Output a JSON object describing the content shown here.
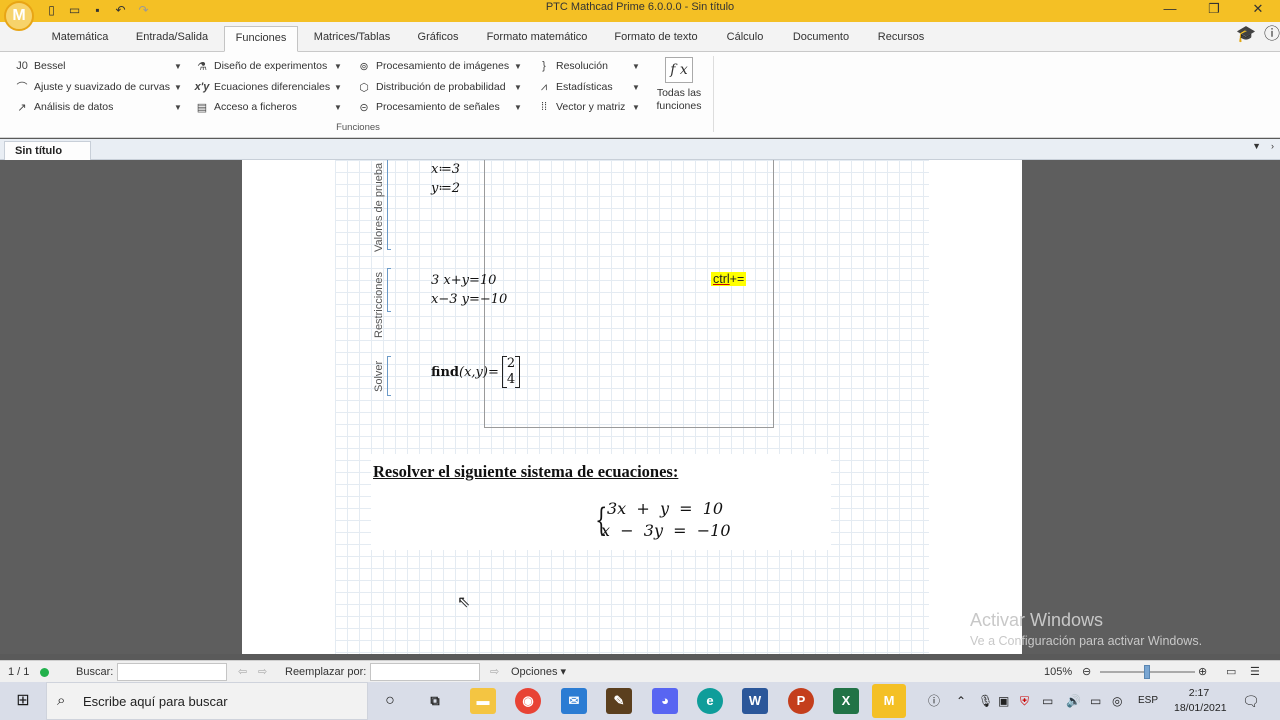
{
  "window": {
    "title": "PTC Mathcad Prime 6.0.0.0 - Sin título",
    "logo_letter": "M"
  },
  "ribbon_tabs": [
    "Matemática",
    "Entrada/Salida",
    "Funciones",
    "Matrices/Tablas",
    "Gráficos",
    "Formato matemático",
    "Formato de texto",
    "Cálculo",
    "Documento",
    "Recursos"
  ],
  "active_tab": "Funciones",
  "ribbon": {
    "col1": [
      "Bessel",
      "Ajuste y suavizado de curvas",
      "Análisis de datos"
    ],
    "col2": [
      "Diseño de experimentos",
      "Ecuaciones diferenciales",
      "Acceso a ficheros"
    ],
    "col3": [
      "Procesamiento de imágenes",
      "Distribución de probabilidad",
      "Procesamiento de señales"
    ],
    "col4": [
      "Resolución",
      "Estadísticas",
      "Vector y matriz"
    ],
    "all_functions_line1": "Todas las",
    "all_functions_line2": "funciones",
    "all_functions_icon": "f x",
    "group_label": "Funciones"
  },
  "document_tab": "Sin título",
  "worksheet": {
    "section_labels": [
      "Valores de prueba",
      "Restricciones",
      "Solver"
    ],
    "guess_x": "x≔3",
    "guess_y": "y≔2",
    "constraint1": "3 x+y=10",
    "constraint2": "x−3 y=−10",
    "find_func": "find",
    "find_args": "(x,y)=",
    "result": [
      "2",
      "4"
    ],
    "hint_a": "ctrl",
    "hint_b": "+=",
    "problem_title": "Resolver el siguiente sistema de ecuaciones:",
    "system_eq1": "3x  +  y  =  10",
    "system_eq2": "x  −  3y  =  −10"
  },
  "watermark": {
    "line1": "Activar Windows",
    "line2": "Ve a Configuración para activar Windows."
  },
  "statusbar": {
    "page": "1 / 1",
    "find_label": "Buscar:",
    "find_value": "",
    "replace_label": "Reemplazar por:",
    "replace_value": "",
    "options": "Opciones",
    "zoom": "105%",
    "zoom_level_percent": 105
  },
  "taskbar": {
    "search_placeholder": "Escribe aquí para buscar",
    "apps": [
      "task-view",
      "file-explorer",
      "chrome",
      "mail",
      "app-pen",
      "discord",
      "edge",
      "word",
      "powerpoint",
      "excel",
      "mathcad"
    ],
    "language": "ESP",
    "time": "2:17",
    "date": "18/01/2021"
  },
  "colors": {
    "title_bar": "#f4c025",
    "hint_highlight": "#ffff00",
    "region_bracket": "#6b9ac8"
  }
}
